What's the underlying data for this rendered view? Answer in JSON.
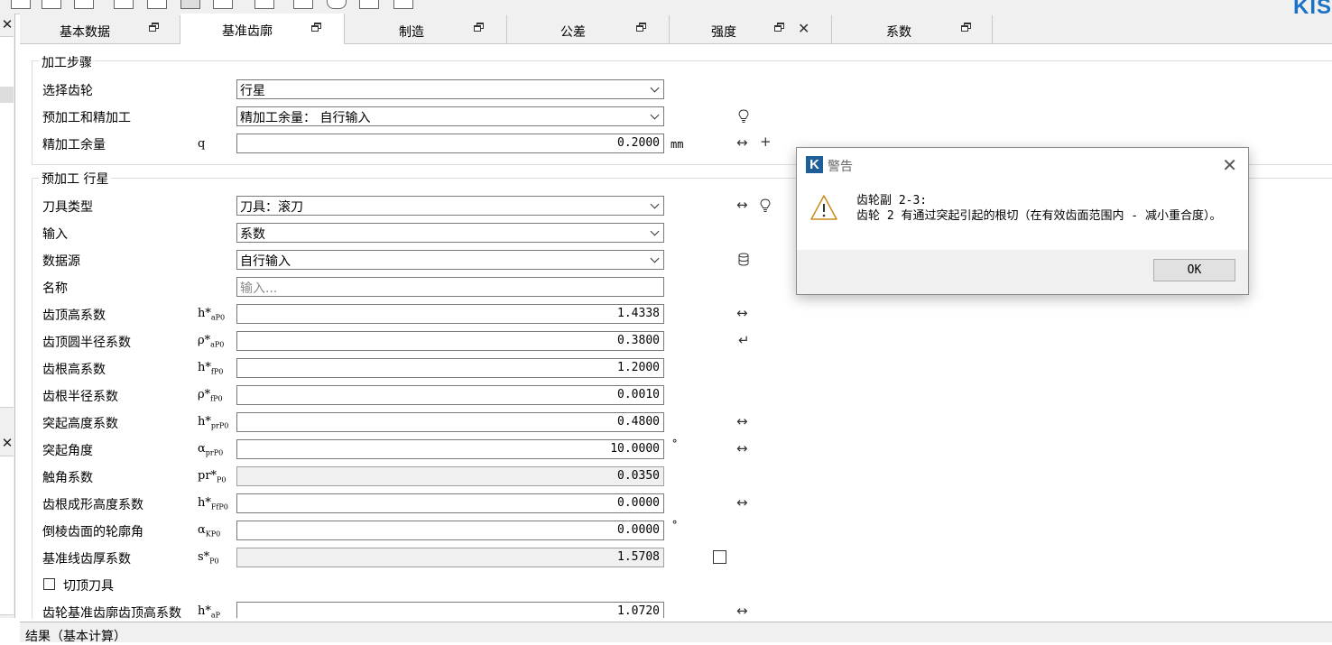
{
  "brand": "KIS",
  "tabs": [
    {
      "label": "基本数据"
    },
    {
      "label": "基准齿廓"
    },
    {
      "label": "制造"
    },
    {
      "label": "公差"
    },
    {
      "label": "强度"
    },
    {
      "label": "系数"
    }
  ],
  "group1": {
    "title": "加工步骤",
    "rows": [
      {
        "label": "选择齿轮",
        "value": "行星"
      },
      {
        "label": "预加工和精加工",
        "value": "精加工余量：  自行输入"
      },
      {
        "label": "精加工余量",
        "symbol": "q",
        "value": "0.2000",
        "unit": "mm"
      }
    ]
  },
  "group2": {
    "title": "预加工 行星",
    "rows": [
      {
        "label": "刀具类型",
        "value": "刀具：滚刀"
      },
      {
        "label": "输入",
        "value": "系数"
      },
      {
        "label": "数据源",
        "value": "自行输入"
      },
      {
        "label": "名称",
        "placeholder": "输入..."
      },
      {
        "label": "齿顶高系数",
        "sym": "h*",
        "sub": "aP0",
        "value": "1.4338"
      },
      {
        "label": "齿顶圆半径系数",
        "sym": "ρ*",
        "sub": "aP0",
        "value": "0.3800"
      },
      {
        "label": "齿根高系数",
        "sym": "h*",
        "sub": "fP0",
        "value": "1.2000"
      },
      {
        "label": "齿根半径系数",
        "sym": "ρ*",
        "sub": "fP0",
        "value": "0.0010"
      },
      {
        "label": "突起高度系数",
        "sym": "h*",
        "sub": "prP0",
        "value": "0.4800"
      },
      {
        "label": "突起角度",
        "sym": "α",
        "sub": "prP0",
        "value": "10.0000",
        "unit": "°"
      },
      {
        "label": "触角系数",
        "sym": "pr*",
        "sub": "P0",
        "value": "0.0350"
      },
      {
        "label": "齿根成形高度系数",
        "sym": "h*",
        "sub": "FfP0",
        "value": "0.0000"
      },
      {
        "label": "倒棱齿面的轮廓角",
        "sym": "α",
        "sub": "KP0",
        "value": "0.0000",
        "unit": "°"
      },
      {
        "label": "基准线齿厚系数",
        "sym": "s*",
        "sub": "P0",
        "value": "1.5708"
      },
      {
        "label": "切顶刀具"
      },
      {
        "label": "齿轮基准齿廓齿顶高系数",
        "sym": "h*",
        "sub": "aP",
        "value": "1.0720"
      }
    ]
  },
  "bottom": {
    "label": "结果（基本计算）"
  },
  "dialog": {
    "title": "警告",
    "line1": "齿轮副 2-3:",
    "line2": "齿轮 2 有通过突起引起的根切（在有效齿面范围内 - 减小重合度）。",
    "ok": "OK"
  },
  "icons": {
    "swap": "↔",
    "plus": "+",
    "enter": "↵",
    "close": "✕"
  }
}
